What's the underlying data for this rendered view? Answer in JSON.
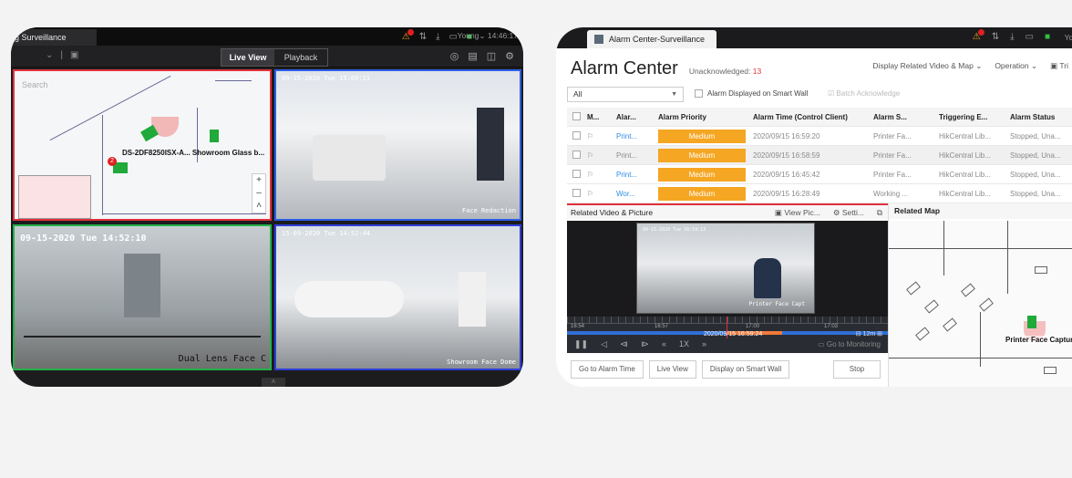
{
  "left_window": {
    "tab_title": "g Surveillance",
    "user": "Young",
    "clock": "14:46:17",
    "view_modes": [
      "Live View",
      "Playback"
    ],
    "active_view": "Live View",
    "map_tile": {
      "search_placeholder": "Search",
      "camera_label": "DS-2DF8250ISX-A... Showroom Glass b...",
      "badge_number": "2"
    },
    "tiles": [
      {
        "timestamp": "09-15-2020 Tue 15:09:11",
        "caption": "Face Redaction"
      },
      {
        "timestamp": "09-15-2020 Tue 14:52:10",
        "caption": "Dual Lens Face C"
      },
      {
        "timestamp": "15-09-2020 Tue 14:52:44",
        "caption": "Showroom Face Dome"
      }
    ]
  },
  "right_window": {
    "tab_title": "Alarm Center-Surveillance",
    "user": "You",
    "header_title": "Alarm Center",
    "unacknowledged_label": "Unacknowledged:",
    "unacknowledged_count": "13",
    "display_related": "Display Related Video & Map",
    "operation": "Operation",
    "trigger_short": "Tri",
    "filter_select": "All",
    "wall_checkbox_label": "Alarm Displayed on Smart Wall",
    "batch_ack": "Batch Acknowledge",
    "columns": [
      "M...",
      "Alar...",
      "Alarm Priority",
      "Alarm Time (Control Client)",
      "Alarm S...",
      "Triggering E...",
      "Alarm Status"
    ],
    "rows": [
      {
        "name": "Print...",
        "priority": "Medium",
        "time": "2020/09/15 16:59:20",
        "source": "Printer Fa...",
        "trigger": "HikCentral Lib...",
        "status": "Stopped, Una..."
      },
      {
        "name": "Print...",
        "priority": "Medium",
        "time": "2020/09/15 16:58:59",
        "source": "Printer Fa...",
        "trigger": "HikCentral Lib...",
        "status": "Stopped, Una..."
      },
      {
        "name": "Print...",
        "priority": "Medium",
        "time": "2020/09/15 16:45:42",
        "source": "Printer Fa...",
        "trigger": "HikCentral Lib...",
        "status": "Stopped, Una..."
      },
      {
        "name": "Wor...",
        "priority": "Medium",
        "time": "2020/09/15 16:28:49",
        "source": "Working ...",
        "trigger": "HikCentral Lib...",
        "status": "Stopped, Una..."
      }
    ],
    "related_video": {
      "title": "Related Video & Picture",
      "view_pic": "View Pic...",
      "settings": "Setti...",
      "frame_caption": "Printer Face Capt",
      "frame_timestamp": "09-15-2020 Tue 16:59:13",
      "timeline_labels": [
        "16:54",
        "16:57",
        "17:00",
        "17:03"
      ],
      "timeline_date": "2020/09/15 16:59:24",
      "zoom_label": "12m",
      "speed": "1X",
      "go_to_monitoring": "Go to Monitoring",
      "buttons": [
        "Go to Alarm Time",
        "Live View",
        "Display on Smart Wall"
      ],
      "stop": "Stop"
    },
    "related_map": {
      "title": "Related Map",
      "camera_label": "Printer Face Capture"
    }
  },
  "colors": {
    "alarm_red": "#e0303a",
    "priority_medium": "#f5a623",
    "link_blue": "#2e8ee8",
    "camera_green": "#1faa3a"
  }
}
